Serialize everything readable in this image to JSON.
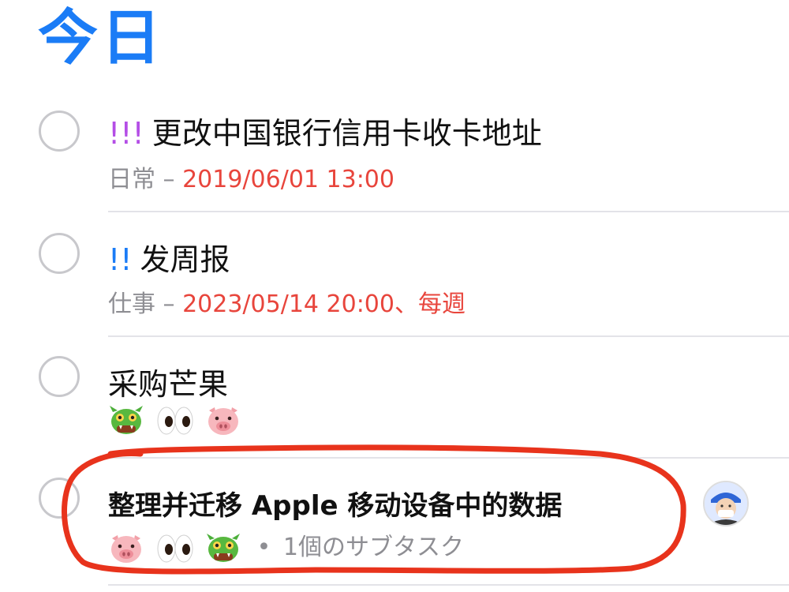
{
  "header": {
    "title": "今日"
  },
  "tasks": [
    {
      "priority": "!!!",
      "priority_color": "#b44ee6",
      "title": "更改中国银行信用卡收卡地址",
      "list": "日常",
      "separator": " – ",
      "due": "2019/06/01 13:00",
      "repeat": ""
    },
    {
      "priority": "!!",
      "priority_color": "#1b7cf6",
      "title": "发周报",
      "list": "仕事",
      "separator": " – ",
      "due": "2023/05/14 20:00",
      "repeat": "、每週"
    },
    {
      "priority": "",
      "title": "采购芒果",
      "tags": [
        "dragon",
        "eyes",
        "pig"
      ]
    },
    {
      "priority": "",
      "title": "整理并迁移 Apple 移动设备中的数据",
      "tags": [
        "pig",
        "eyes",
        "dragon"
      ],
      "subtask_bullet": "•",
      "subtask_text": "1個のサブタスク",
      "has_avatar": true
    }
  ],
  "colors": {
    "accent": "#1b7cf6",
    "due": "#e8453c",
    "annotation": "#e8331c"
  }
}
